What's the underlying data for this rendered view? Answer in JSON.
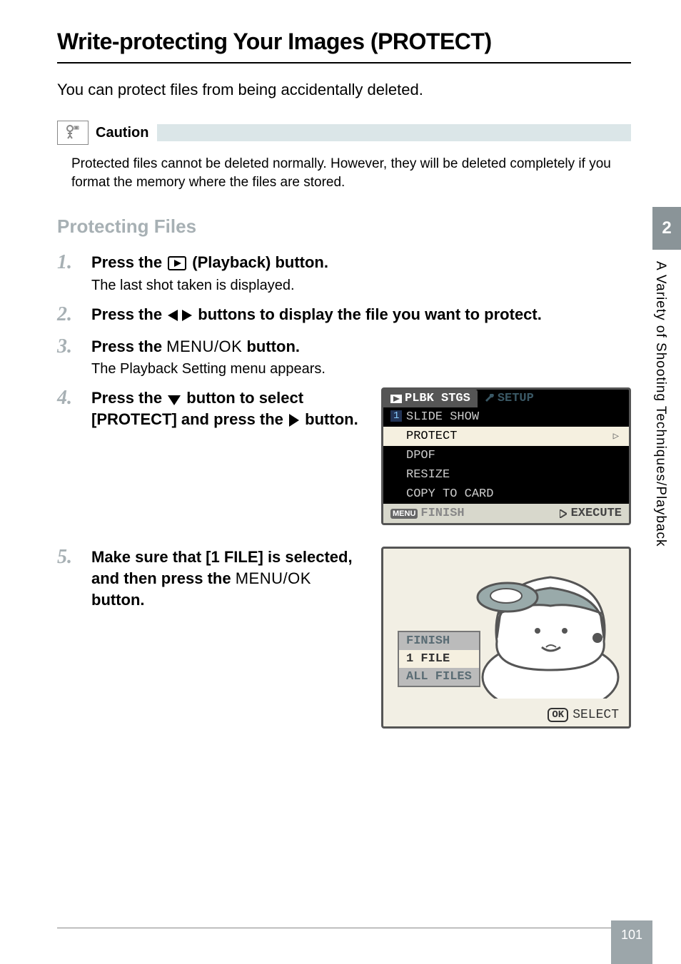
{
  "title": "Write-protecting Your Images (PROTECT)",
  "intro": "You can protect files from being accidentally deleted.",
  "caution": {
    "label": "Caution",
    "text": "Protected files cannot be deleted normally. However, they will be deleted completely if you format the memory where the files are stored."
  },
  "section_heading": "Protecting Files",
  "steps": {
    "s1_a": "Press the ",
    "s1_b": " (Playback) button.",
    "s1_sub": "The last shot taken is displayed.",
    "s2_a": "Press the ",
    "s2_b": " buttons to display the file you want to protect.",
    "s3_a": "Press the ",
    "s3_menuok": "MENU/OK",
    "s3_b": " button.",
    "s3_sub": "The Playback Setting menu appears.",
    "s4_a": "Press the ",
    "s4_b": " button to select [PROTECT] and press the ",
    "s4_c": " button.",
    "s5_a": "Make sure that [1 FILE] is selected, and then press the ",
    "s5_menuok": "MENU/OK",
    "s5_b": " button."
  },
  "screenshot1": {
    "tab_active": "PLBK STGS",
    "tab_inactive": "SETUP",
    "page_num": "1",
    "items": [
      "SLIDE SHOW",
      "PROTECT",
      "DPOF",
      "RESIZE",
      "COPY TO CARD"
    ],
    "highlight_index": 1,
    "footer_left_badge": "MENU",
    "footer_left": "FINISH",
    "footer_right": "EXECUTE"
  },
  "screenshot2": {
    "menu": [
      "FINISH",
      "1 FILE",
      "ALL FILES"
    ],
    "selected_index": 1,
    "ok_label": "OK",
    "select_label": "SELECT"
  },
  "side": {
    "chapter": "2",
    "label": "A Variety of Shooting Techniques/Playback"
  },
  "page_number": "101"
}
